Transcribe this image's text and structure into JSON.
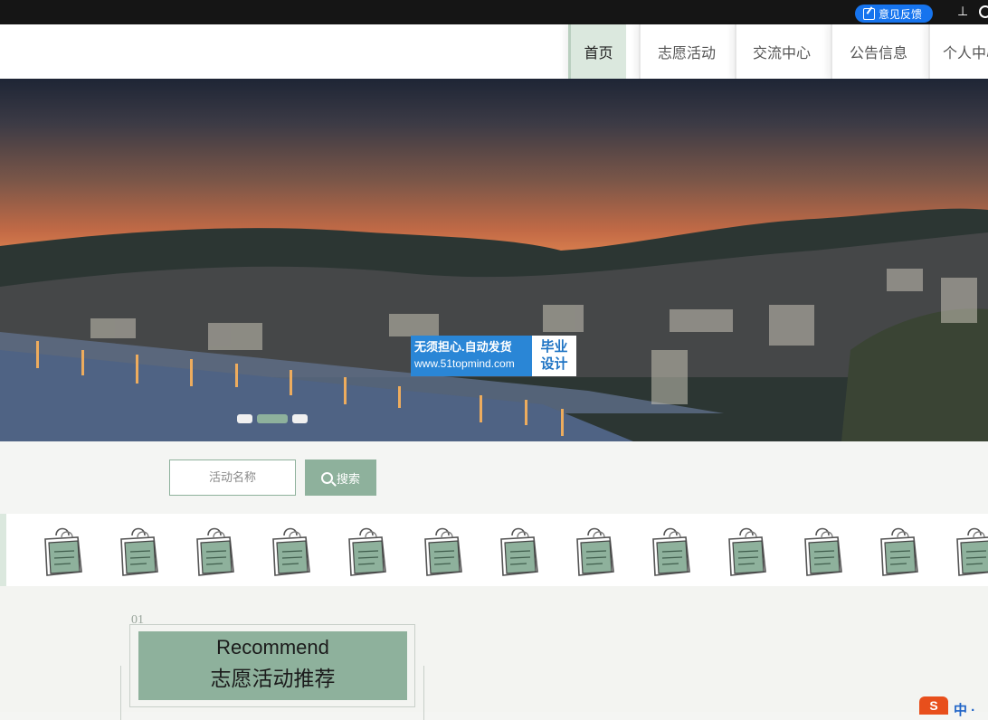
{
  "topbar": {
    "feedback_label": "意见反馈",
    "pin_icon": "pin-icon"
  },
  "nav": {
    "items": [
      {
        "label": "首页",
        "active": true
      },
      {
        "label": "志愿活动",
        "active": false
      },
      {
        "label": "交流中心",
        "active": false
      },
      {
        "label": "公告信息",
        "active": false
      },
      {
        "label": "个人中心",
        "active": false
      }
    ]
  },
  "banner": {
    "watermark_line1": "无须担心.自动发货",
    "watermark_url": "www.51topmind.com",
    "watermark_badge1": "毕业",
    "watermark_badge2": "设计",
    "slides": 3,
    "active_slide": 2
  },
  "search": {
    "placeholder": "活动名称",
    "button_label": "搜索"
  },
  "strip": {
    "icon": "notebook-bag-icon",
    "count": 13
  },
  "section": {
    "number": "01",
    "title_en": "Recommend",
    "title_cn": "志愿活动推荐"
  },
  "corner": {
    "logo": "S",
    "text": "中 ·"
  },
  "colors": {
    "accent": "#8eb19c",
    "accent_light": "#dbe8de",
    "feedback_blue": "#1674ee",
    "topbar": "#151515"
  }
}
